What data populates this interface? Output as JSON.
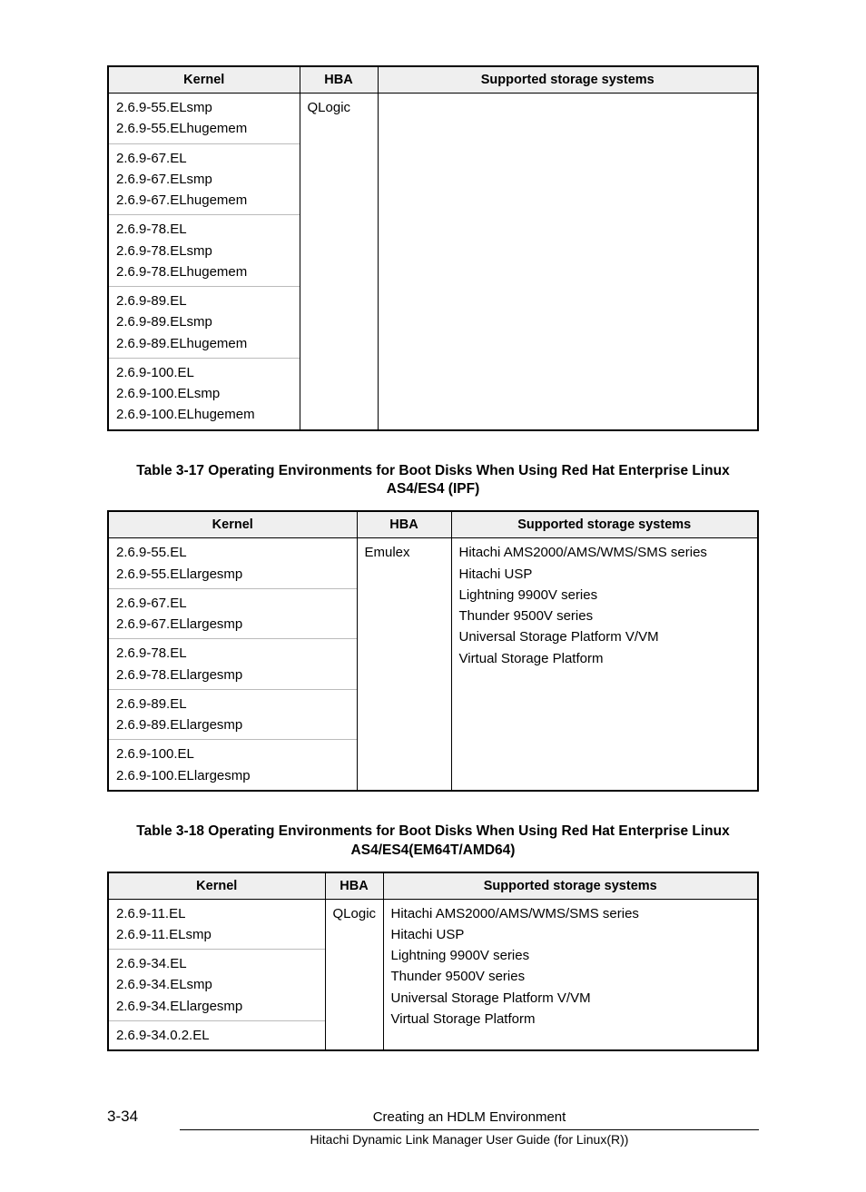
{
  "tables": {
    "t1": {
      "headers": {
        "kernel": "Kernel",
        "hba": "HBA",
        "sss": "Supported storage systems"
      },
      "rows": [
        {
          "kernel": "2.6.9-55.ELsmp\n2.6.9-55.ELhugemem",
          "hba": "QLogic",
          "sss": ""
        },
        {
          "kernel": "2.6.9-67.EL\n2.6.9-67.ELsmp\n2.6.9-67.ELhugemem"
        },
        {
          "kernel": "2.6.9-78.EL\n2.6.9-78.ELsmp\n2.6.9-78.ELhugemem"
        },
        {
          "kernel": "2.6.9-89.EL\n2.6.9-89.ELsmp\n2.6.9-89.ELhugemem"
        },
        {
          "kernel": "2.6.9-100.EL\n2.6.9-100.ELsmp\n2.6.9-100.ELhugemem"
        }
      ]
    },
    "t2": {
      "caption": "Table 3-17 Operating Environments for Boot Disks When Using Red Hat Enterprise Linux AS4/ES4 (IPF)",
      "headers": {
        "kernel": "Kernel",
        "hba": "HBA",
        "sss": "Supported storage systems"
      },
      "rows": [
        {
          "kernel": "2.6.9-55.EL\n2.6.9-55.ELlargesmp",
          "hba": "Emulex",
          "sss": "Hitachi AMS2000/AMS/WMS/SMS series\nHitachi USP\nLightning 9900V series\nThunder 9500V series\nUniversal Storage Platform V/VM\nVirtual Storage Platform"
        },
        {
          "kernel": "2.6.9-67.EL\n2.6.9-67.ELlargesmp"
        },
        {
          "kernel": "2.6.9-78.EL\n2.6.9-78.ELlargesmp"
        },
        {
          "kernel": "2.6.9-89.EL\n2.6.9-89.ELlargesmp"
        },
        {
          "kernel": "2.6.9-100.EL\n2.6.9-100.ELlargesmp"
        }
      ]
    },
    "t3": {
      "caption": "Table 3-18 Operating Environments for Boot Disks When Using Red Hat Enterprise Linux AS4/ES4(EM64T/AMD64)",
      "headers": {
        "kernel": "Kernel",
        "hba": "HBA",
        "sss": "Supported storage systems"
      },
      "rows": [
        {
          "kernel": "2.6.9-11.EL\n2.6.9-11.ELsmp",
          "hba": "QLogic",
          "sss": "Hitachi AMS2000/AMS/WMS/SMS series\nHitachi USP\nLightning 9900V series\nThunder 9500V series\nUniversal Storage Platform V/VM\nVirtual Storage Platform"
        },
        {
          "kernel": "2.6.9-34.EL\n2.6.9-34.ELsmp\n2.6.9-34.ELlargesmp"
        },
        {
          "kernel": "2.6.9-34.0.2.EL"
        }
      ]
    }
  },
  "footer": {
    "page": "3-34",
    "section": "Creating an HDLM Environment",
    "book": "Hitachi Dynamic Link Manager User Guide (for Linux(R))"
  }
}
